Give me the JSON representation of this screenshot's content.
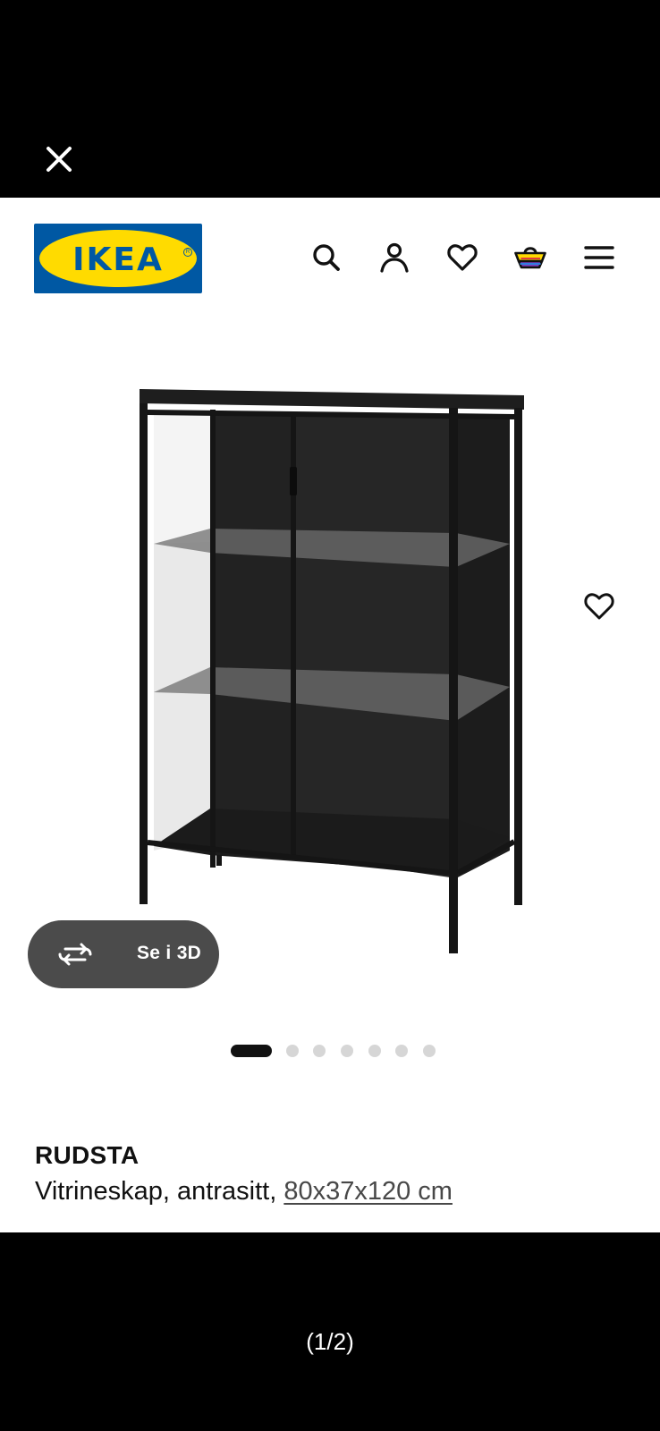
{
  "viewer": {
    "counter": "(1/2)"
  },
  "header": {
    "logo_text": "IKEA",
    "icons": [
      "search-icon",
      "account-icon",
      "heart-icon",
      "basket-icon",
      "menu-icon"
    ]
  },
  "gallery": {
    "view_3d_label": "Se i 3D",
    "image_count": 7,
    "active_image": 1
  },
  "product": {
    "name": "RUDSTA",
    "description": "Vitrineskap, antrasitt,",
    "size": "80x37x120 cm"
  },
  "colors": {
    "brand_blue": "#0058a3",
    "brand_yellow": "#ffdb00",
    "viewer_background": "#000000",
    "pill_background": "#4b4b4b"
  }
}
